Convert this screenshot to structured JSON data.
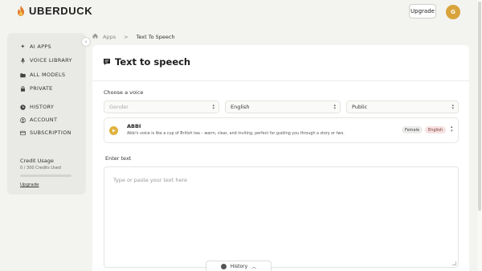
{
  "header": {
    "logo_text": "UBERDUCK",
    "upgrade_label": "Upgrade",
    "avatar_initial": "G"
  },
  "sidebar": {
    "collapse_icon": "chevron-left-icon",
    "items": [
      {
        "label": "AI APPS",
        "icon": "sparkle-icon"
      },
      {
        "label": "VOICE LIBRARY",
        "icon": "microphone-icon"
      },
      {
        "label": "ALL MODELS",
        "icon": "folder-icon"
      },
      {
        "label": "PRIVATE",
        "icon": "lock-icon"
      },
      {
        "label": "HISTORY",
        "icon": "clock-icon"
      },
      {
        "label": "ACCOUNT",
        "icon": "user-icon"
      },
      {
        "label": "SUBSCRIPTION",
        "icon": "card-icon"
      }
    ],
    "credits": {
      "title": "Credit Usage",
      "usage_text": "0 / 300 Credits Used",
      "fraction_used": 0,
      "link_label": "Upgrade"
    }
  },
  "breadcrumb": {
    "home_icon": "home-icon",
    "items": [
      "Apps",
      "Text To Speech"
    ]
  },
  "main": {
    "title": "Text to speech",
    "title_icon": "speech-bubble-icon",
    "voice_section_label": "Choose a voice",
    "filters": {
      "gender_placeholder": "Gender",
      "language_value": "English",
      "visibility_value": "Public"
    },
    "voice": {
      "name": "ABBI",
      "description": "Abbi's voice is like a cup of British tea – warm, clear, and inviting, perfect for guiding you through a story or two.",
      "gender_tag": "Female",
      "language_tag": "English"
    },
    "text_section_label": "Enter text",
    "text_placeholder": "Type or paste your text here"
  },
  "history_bar": {
    "label": "History",
    "icon": "history-icon"
  },
  "colors": {
    "accent": "#e0b23f",
    "background": "#f3f3f0",
    "sidebar_bg": "#e9e9e5",
    "avatar": "#d9a33b"
  }
}
